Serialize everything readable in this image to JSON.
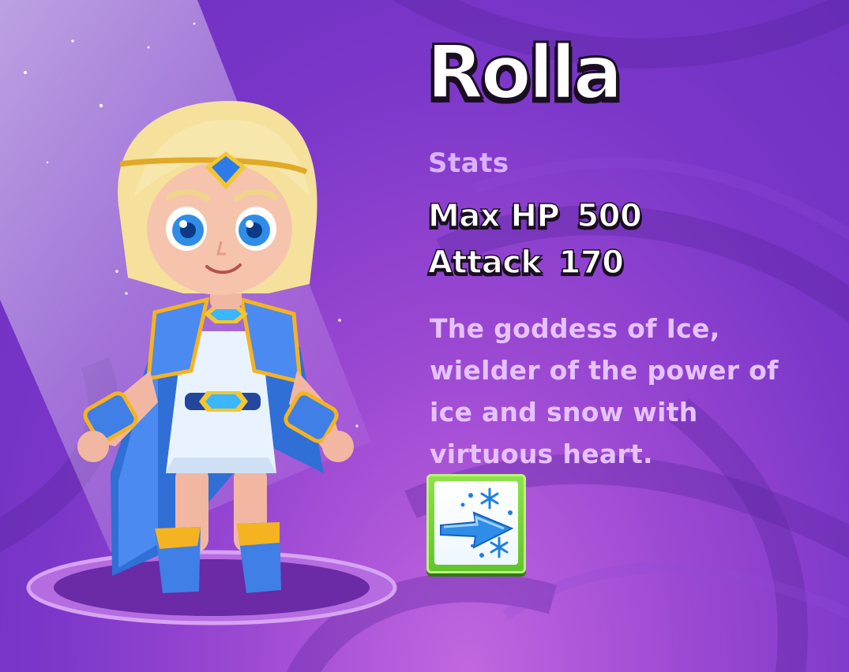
{
  "hero": {
    "name": "Rolla",
    "stats_heading": "Stats",
    "stats": [
      {
        "label": "Max HP",
        "value": "500"
      },
      {
        "label": "Attack",
        "value": "170"
      }
    ],
    "description_lines": [
      "The goddess of Ice,",
      "wielder of the power of",
      "ice and snow with",
      "virtuous heart."
    ]
  },
  "skill": {
    "icon": "ice-arrow-snowflake-icon"
  },
  "colors": {
    "background": "#7a36c8",
    "title_text": "#ffffff",
    "stats_heading": "#dab2ff",
    "description": "#e6c2ff",
    "skill_button": "#6ccf34"
  }
}
